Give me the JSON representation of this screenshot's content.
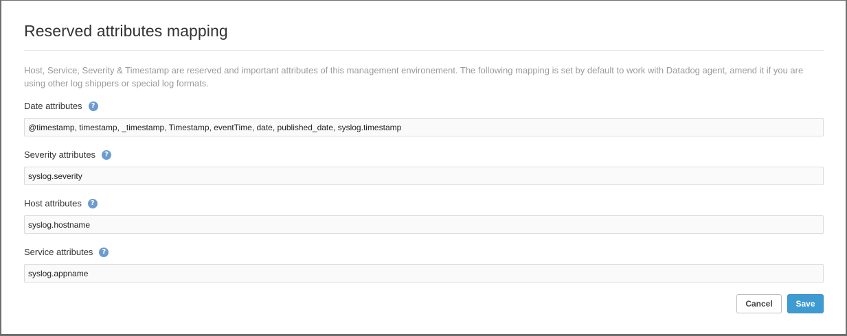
{
  "dialog": {
    "title": "Reserved attributes mapping",
    "description": "Host, Service, Severity & Timestamp are reserved and important attributes of this management environement. The following mapping is set by default to work with Datadog agent, amend it if you are using other log shippers or special log formats."
  },
  "fields": [
    {
      "label": "Date attributes",
      "help_icon": "question-circle-icon",
      "value": "@timestamp, timestamp, _timestamp, Timestamp, eventTime, date, published_date, syslog.timestamp"
    },
    {
      "label": "Severity attributes",
      "help_icon": "question-circle-icon",
      "value": "syslog.severity"
    },
    {
      "label": "Host attributes",
      "help_icon": "question-circle-icon",
      "value": "syslog.hostname"
    },
    {
      "label": "Service attributes",
      "help_icon": "question-circle-icon",
      "value": "syslog.appname"
    }
  ],
  "help_glyph": "?",
  "buttons": {
    "cancel_label": "Cancel",
    "save_label": "Save"
  },
  "colors": {
    "accent": "#3d9bd1",
    "help_icon": "#6c9bd2",
    "description_text": "#9a9a9a"
  }
}
